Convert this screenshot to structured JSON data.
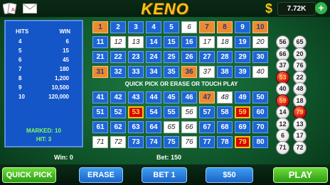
{
  "header": {
    "title": "KENO",
    "balance": "7.72K",
    "icons": [
      "cards-icon",
      "mail-icon",
      "dollar-icon",
      "plus-icon"
    ]
  },
  "paytable": {
    "hits_header": "HITS",
    "win_header": "WIN",
    "rows": [
      {
        "hits": "4",
        "win": "6"
      },
      {
        "hits": "5",
        "win": "15"
      },
      {
        "hits": "6",
        "win": "45"
      },
      {
        "hits": "7",
        "win": "180"
      },
      {
        "hits": "8",
        "win": "1,200"
      },
      {
        "hits": "9",
        "win": "10,500"
      },
      {
        "hits": "10",
        "win": "120,000"
      }
    ],
    "marked": "MARKED: 10",
    "hit": "HIT: 3"
  },
  "board": {
    "message": "QUICK PICK OR ERASE OR TOUCH PLAY",
    "picked": [
      1,
      7,
      8,
      10,
      31,
      36,
      47,
      53,
      59,
      79
    ],
    "drawn": [
      6,
      12,
      13,
      17,
      18,
      20,
      37,
      40,
      48,
      56,
      65,
      66,
      71,
      72,
      76
    ],
    "hits": [
      53,
      59,
      79
    ]
  },
  "drawn_balls": [
    {
      "num": "56",
      "hit": false
    },
    {
      "num": "65",
      "hit": false
    },
    {
      "num": "66",
      "hit": false
    },
    {
      "num": "20",
      "hit": false
    },
    {
      "num": "37",
      "hit": false
    },
    {
      "num": "76",
      "hit": false
    },
    {
      "num": "53",
      "hit": true
    },
    {
      "num": "22",
      "hit": false
    },
    {
      "num": "40",
      "hit": false
    },
    {
      "num": "48",
      "hit": false
    },
    {
      "num": "59",
      "hit": true
    },
    {
      "num": "18",
      "hit": false
    },
    {
      "num": "14",
      "hit": false
    },
    {
      "num": "79",
      "hit": true
    },
    {
      "num": "12",
      "hit": false
    },
    {
      "num": "13",
      "hit": false
    },
    {
      "num": "6",
      "hit": false
    },
    {
      "num": "17",
      "hit": false
    },
    {
      "num": "71",
      "hit": false
    },
    {
      "num": "72",
      "hit": false
    }
  ],
  "status": {
    "win": "Win: 0",
    "bet": "Bet: 150"
  },
  "buttons": {
    "quick_pick": "QUICK PICK",
    "erase": "ERASE",
    "bet": "BET 1",
    "amount": "$50",
    "play": "PLAY"
  },
  "colors": {
    "pick": "#ee8a2e",
    "hit": "#d80000",
    "cell": "#1e66d6",
    "felt": "#10582c"
  }
}
